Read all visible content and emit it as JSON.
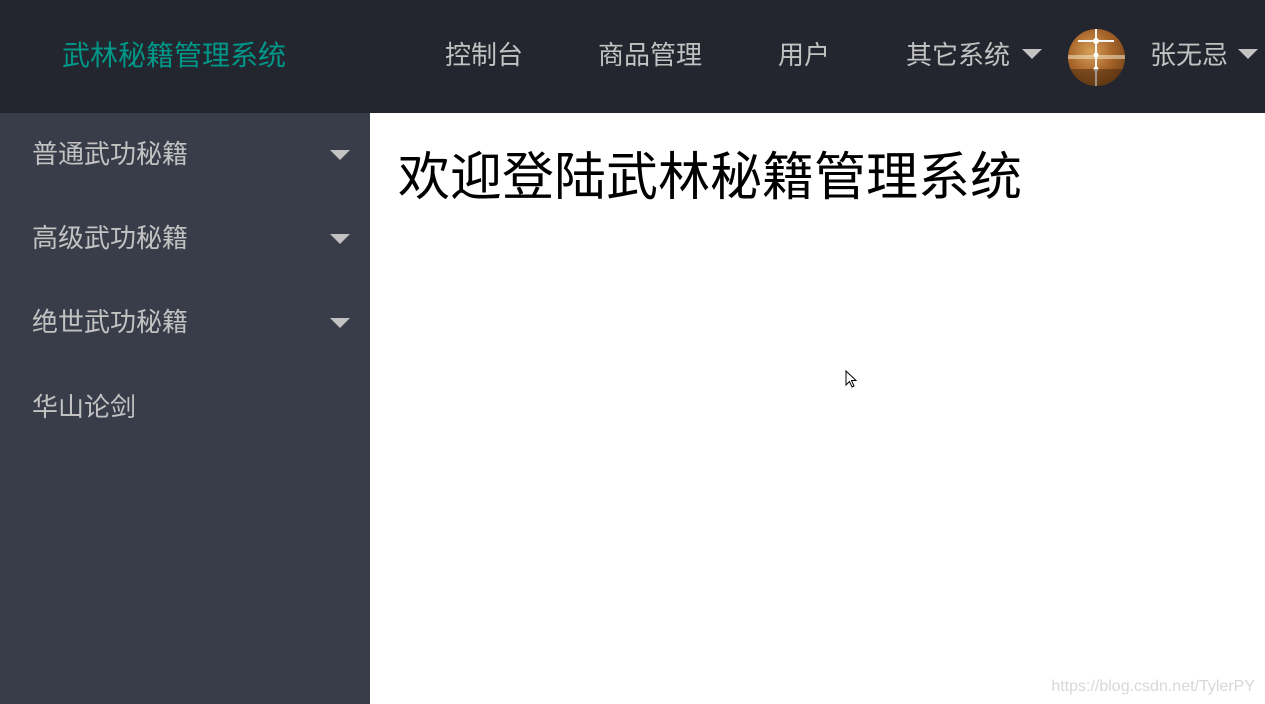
{
  "header": {
    "logo": "武林秘籍管理系统",
    "nav": [
      "控制台",
      "商品管理",
      "用户",
      "其它系统"
    ],
    "user_name": "张无忌"
  },
  "sidebar": {
    "items": [
      {
        "label": "普通武功秘籍",
        "has_submenu": true
      },
      {
        "label": "高级武功秘籍",
        "has_submenu": true
      },
      {
        "label": "绝世武功秘籍",
        "has_submenu": true
      },
      {
        "label": "华山论剑",
        "has_submenu": false
      }
    ]
  },
  "main": {
    "welcome": "欢迎登陆武林秘籍管理系统"
  },
  "watermark": "https://blog.csdn.net/TylerPY",
  "colors": {
    "header_bg": "#23262e",
    "sidebar_bg": "#393d49",
    "logo": "#009688",
    "menu_text": "#c2c2c2"
  }
}
